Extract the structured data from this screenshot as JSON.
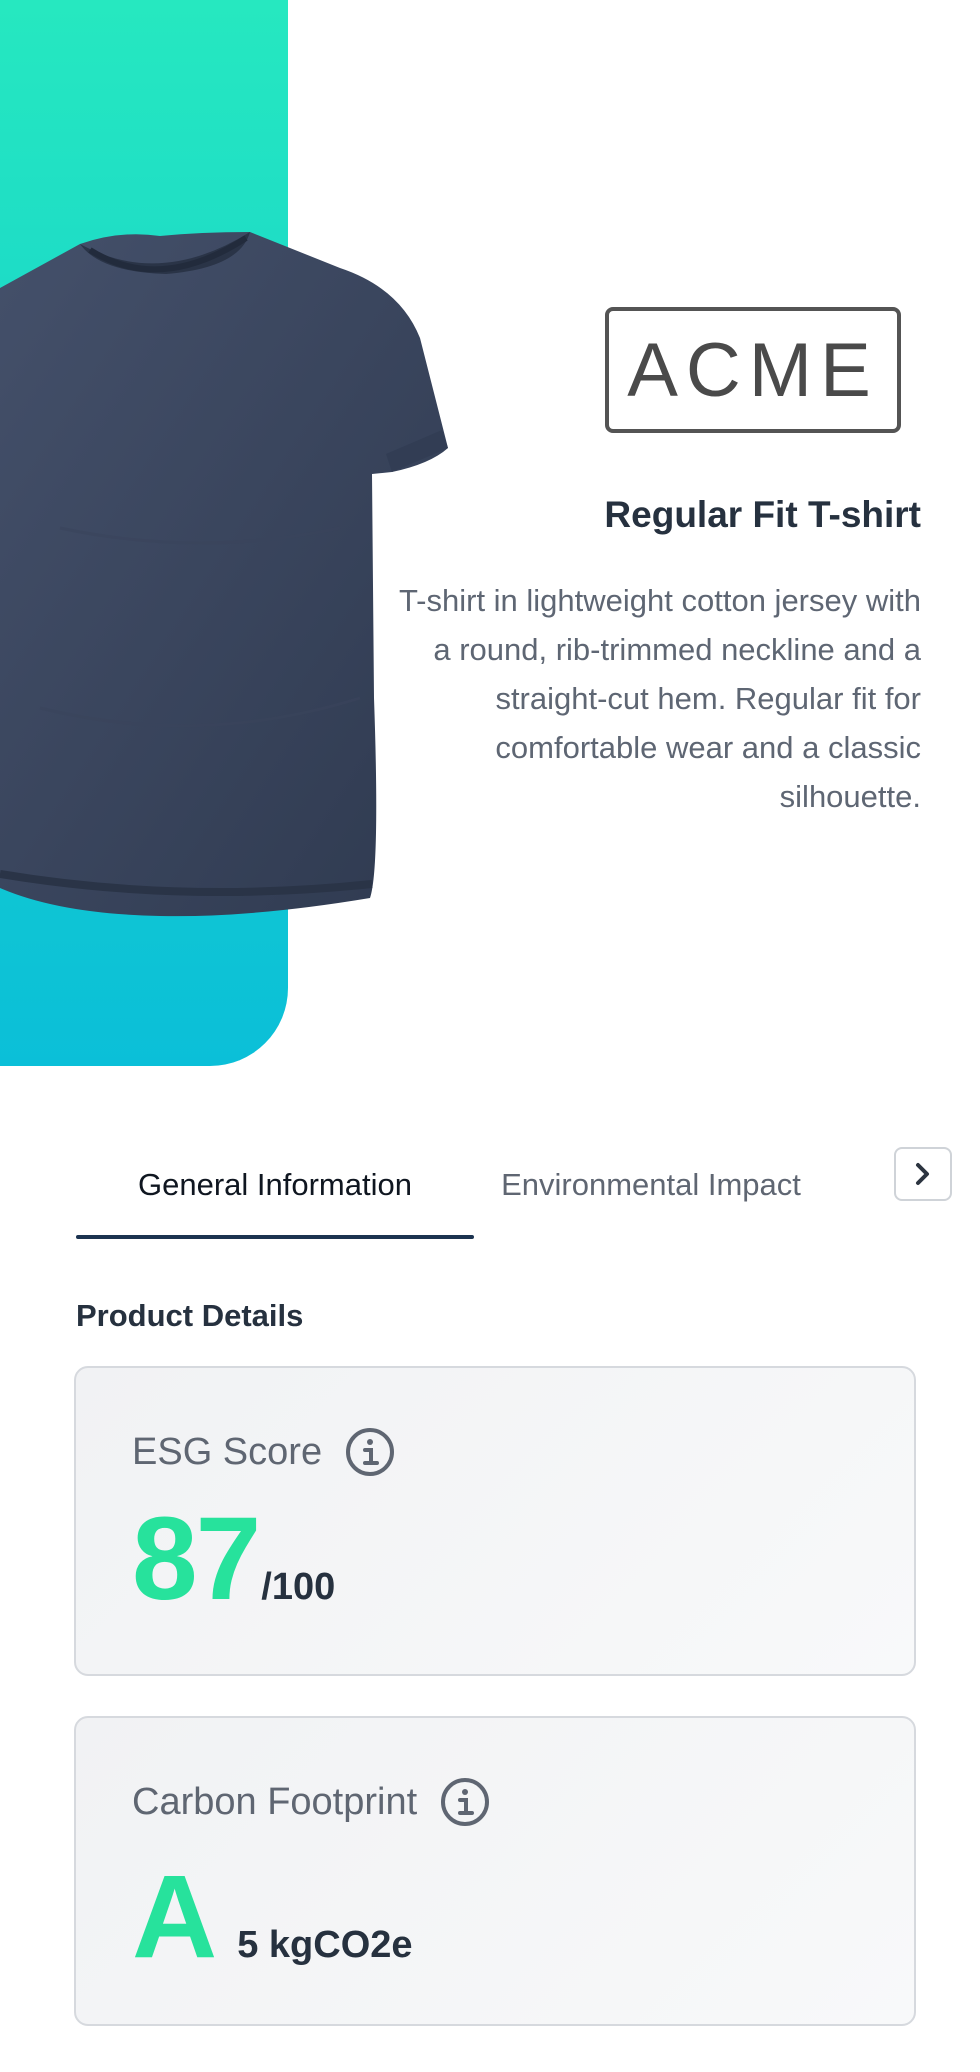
{
  "brand": {
    "logo_text": "ACME"
  },
  "product": {
    "title": "Regular Fit T-shirt",
    "description": "T-shirt in lightweight cotton jersey with a round, rib-trimmed neckline and a straight-cut hem. Regular fit for comfortable wear and a classic silhouette.",
    "image_icon": "t-shirt-image",
    "shirt_color": "#3b465e"
  },
  "tabs": {
    "items": [
      {
        "label": "General Information",
        "active": true
      },
      {
        "label": "Environmental Impact",
        "active": false
      }
    ],
    "next_icon": "chevron-right-icon"
  },
  "section": {
    "title": "Product Details"
  },
  "esg": {
    "label": "ESG Score",
    "value": "87",
    "max": "/100",
    "info_icon": "info-icon"
  },
  "carbon": {
    "label": "Carbon Footprint",
    "grade": "A",
    "amount": "5 kgCO2e",
    "info_icon": "info-icon"
  },
  "colors": {
    "accent_green": "#27e29c",
    "hero_gradient_top": "#26e8c0",
    "hero_gradient_bottom": "#0bbfd8",
    "tab_underline": "#1c3350"
  }
}
